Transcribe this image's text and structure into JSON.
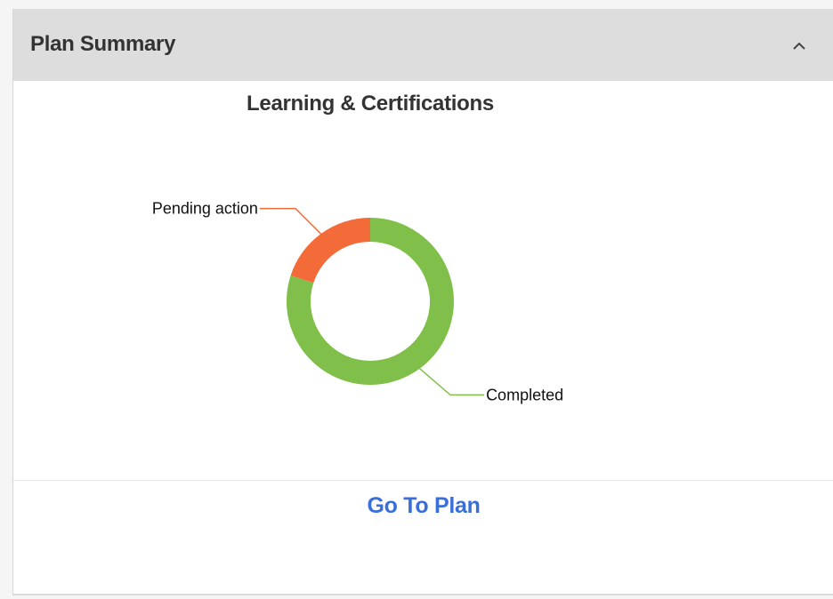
{
  "panel": {
    "title": "Plan Summary",
    "collapse_icon": "chevron-up-icon"
  },
  "chart_data": {
    "type": "pie",
    "title": "Learning & Certifications",
    "donut": true,
    "slices": [
      {
        "label": "Completed",
        "value": 80,
        "color": "#80c04a"
      },
      {
        "label": "Pending action",
        "value": 20,
        "color": "#f26b38"
      }
    ]
  },
  "footer": {
    "link_label": "Go To Plan",
    "link_color": "#3a6fd8"
  }
}
